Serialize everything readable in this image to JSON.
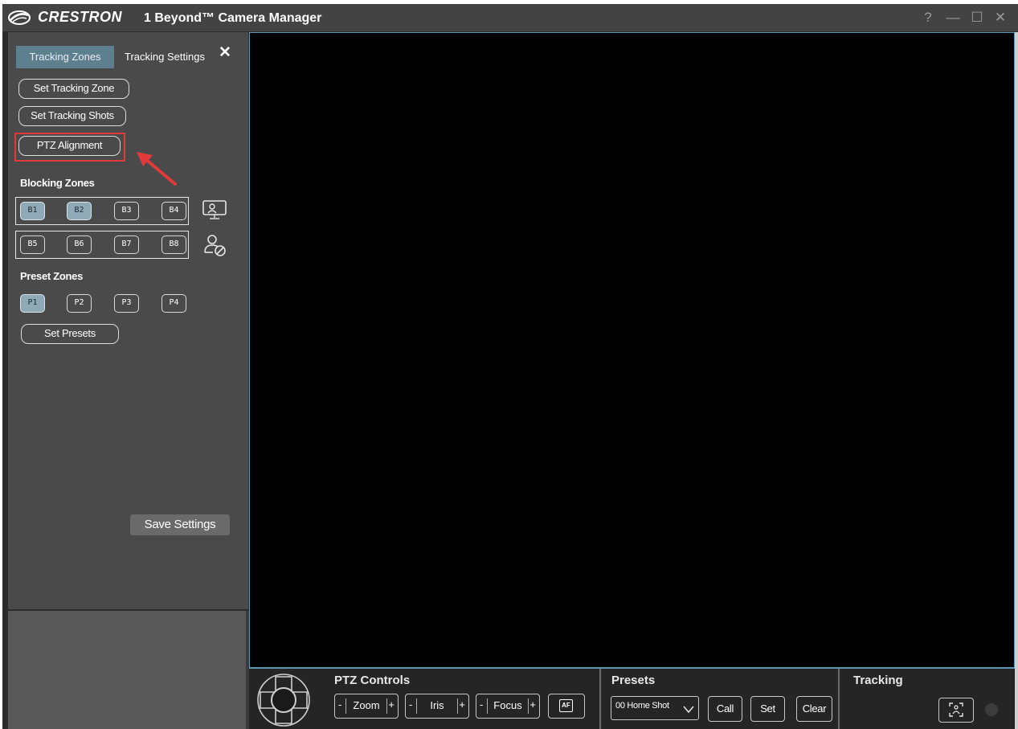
{
  "titlebar": {
    "brand": "CRESTRON",
    "app_title": "1 Beyond™ Camera Manager",
    "help": "?",
    "minimize": "—",
    "maximize": "☐",
    "close": "✕"
  },
  "left_panel": {
    "tabs": [
      {
        "label": "Tracking Zones",
        "active": true
      },
      {
        "label": "Tracking Settings",
        "active": false
      }
    ],
    "close": "✕",
    "buttons": {
      "set_tracking_zone": "Set Tracking Zone",
      "set_tracking_shots": "Set Tracking Shots",
      "ptz_alignment": "PTZ Alignment"
    },
    "blocking_zones": {
      "label": "Blocking Zones",
      "row1": [
        {
          "label": "B1",
          "active": true
        },
        {
          "label": "B2",
          "active": true
        },
        {
          "label": "B3",
          "active": false
        },
        {
          "label": "B4",
          "active": false
        }
      ],
      "row2": [
        {
          "label": "B5",
          "active": false
        },
        {
          "label": "B6",
          "active": false
        },
        {
          "label": "B7",
          "active": false
        },
        {
          "label": "B8",
          "active": false
        }
      ]
    },
    "preset_zones": {
      "label": "Preset Zones",
      "items": [
        {
          "label": "P1",
          "active": true
        },
        {
          "label": "P2",
          "active": false
        },
        {
          "label": "P3",
          "active": false
        },
        {
          "label": "P4",
          "active": false
        }
      ],
      "set_presets": "Set Presets"
    },
    "save_settings": "Save Settings"
  },
  "bottom_bar": {
    "ptz": {
      "title": "PTZ Controls",
      "zoom": "Zoom",
      "iris": "Iris",
      "focus": "Focus",
      "af": "AF",
      "minus": "-",
      "plus": "+"
    },
    "presets": {
      "title": "Presets",
      "selected": "00 Home Shot",
      "call": "Call",
      "set": "Set",
      "clear": "Clear"
    },
    "tracking": {
      "title": "Tracking"
    }
  },
  "colors": {
    "accent": "#5c97b3",
    "active_zone": "#8fa9b7",
    "highlight": "#e03a3a"
  }
}
